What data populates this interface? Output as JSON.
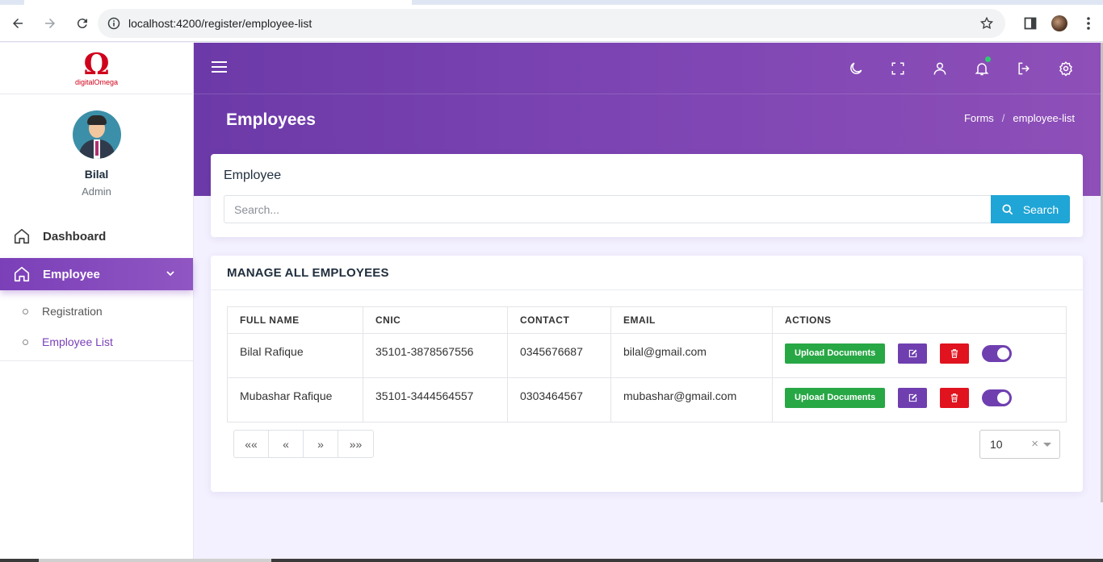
{
  "browser": {
    "url": "localhost:4200/register/employee-list"
  },
  "sidebar": {
    "logo_symbol": "Ω",
    "logo_text": "digitalOmega",
    "user": {
      "name": "Bilal",
      "role": "Admin"
    },
    "items": [
      {
        "label": "Dashboard",
        "icon": "home-icon"
      },
      {
        "label": "Employee",
        "icon": "home-icon",
        "active": true
      }
    ],
    "submenu": [
      {
        "label": "Registration"
      },
      {
        "label": "Employee List",
        "active": true
      }
    ]
  },
  "header": {
    "page_title": "Employees",
    "breadcrumb": [
      "Forms",
      "employee-list"
    ],
    "icons": [
      "moon-icon",
      "fullscreen-icon",
      "user-icon",
      "bell-icon",
      "logout-icon",
      "settings-icon"
    ]
  },
  "search_card": {
    "title": "Employee",
    "placeholder": "Search...",
    "button_label": "Search"
  },
  "table_card": {
    "title": "MANAGE ALL EMPLOYEES",
    "columns": [
      "FULL NAME",
      "CNIC",
      "CONTACT",
      "EMAIL",
      "ACTIONS"
    ],
    "rows": [
      {
        "name": "Bilal Rafique",
        "cnic": "35101-3878567556",
        "contact": "0345676687",
        "email": "bilal@gmail.com"
      },
      {
        "name": "Mubashar Rafique",
        "cnic": "35101-3444564557",
        "contact": "0303464567",
        "email": "mubashar@gmail.com"
      }
    ],
    "upload_label": "Upload Documents",
    "pager": [
      "««",
      "«",
      "»",
      "»»"
    ],
    "page_size": "10",
    "page_size_clear": "×"
  },
  "colors": {
    "primary": "#7b3fb8",
    "search_button": "#1fa5d6",
    "upload_button": "#28a745",
    "delete_button": "#e0131f",
    "logo": "#d0021b"
  }
}
